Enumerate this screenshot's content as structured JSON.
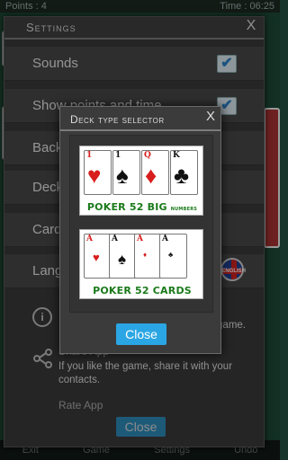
{
  "status": {
    "points": "Points : 4",
    "time": "Time : 06:25"
  },
  "bottom_menu": [
    "Exit",
    "Game",
    "Settings",
    "Undo"
  ],
  "settings": {
    "title": "Settings",
    "close_glyph": "X",
    "rows": [
      {
        "label": "Sounds",
        "checked": true
      },
      {
        "label": "Show points and time",
        "checked": true
      },
      {
        "label": "Background"
      },
      {
        "label": "Deck type"
      },
      {
        "label": "Card back"
      },
      {
        "label": "Language",
        "badge": "ENGLISH"
      }
    ],
    "info": {
      "about_text": "game.",
      "share_title": "Share App",
      "share_text": "If you like the game, share it with your contacts.",
      "rate_title": "Rate App"
    },
    "close_button": "Close"
  },
  "deck_dialog": {
    "title": "Deck type selector",
    "close_glyph": "X",
    "options": [
      {
        "label_main": "POKER 52 BIG",
        "label_small": "NUMBERS",
        "cards": [
          {
            "rank": "1",
            "suit": "♥",
            "color": "red"
          },
          {
            "rank": "1",
            "suit": "♠",
            "color": "black"
          },
          {
            "rank": "Q",
            "suit": "♦",
            "color": "red"
          },
          {
            "rank": "K",
            "suit": "♣",
            "color": "black"
          }
        ]
      },
      {
        "label_main": "POKER 52 CARDS",
        "cards": [
          {
            "rank": "A",
            "suit": "♥",
            "color": "red"
          },
          {
            "rank": "A",
            "suit": "♠",
            "color": "black"
          },
          {
            "rank": "A",
            "suit": "♦",
            "color": "red"
          },
          {
            "rank": "A",
            "suit": "♣",
            "color": "black"
          }
        ]
      }
    ],
    "close_button": "Close"
  },
  "colors": {
    "accent": "#2ba6e4",
    "deck_label": "#1a7a1a"
  }
}
